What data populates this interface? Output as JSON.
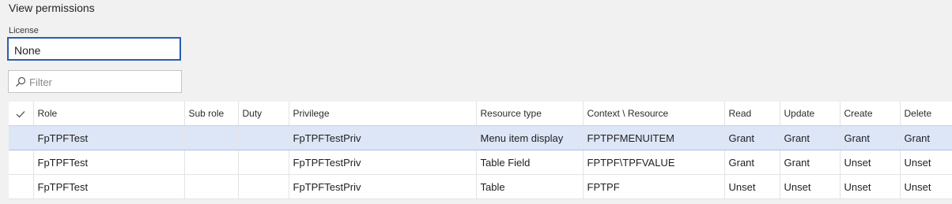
{
  "header": {
    "title": "View permissions"
  },
  "license": {
    "label": "License",
    "value": "None"
  },
  "filter": {
    "placeholder": "Filter"
  },
  "grid": {
    "columns": [
      "Role",
      "Sub role",
      "Duty",
      "Privilege",
      "Resource type",
      "Context \\ Resource",
      "Read",
      "Update",
      "Create",
      "Delete"
    ],
    "rows": [
      [
        "FpTPFTest",
        "",
        "",
        "FpTPFTestPriv",
        "Menu item display",
        "FPTPFMENUITEM",
        "Grant",
        "Grant",
        "Grant",
        "Grant"
      ],
      [
        "FpTPFTest",
        "",
        "",
        "FpTPFTestPriv",
        "Table Field",
        "FPTPF\\TPFVALUE",
        "Grant",
        "Grant",
        "Unset",
        "Unset"
      ],
      [
        "FpTPFTest",
        "",
        "",
        "FpTPFTestPriv",
        "Table",
        "FPTPF",
        "Unset",
        "Unset",
        "Unset",
        "Unset"
      ]
    ],
    "selected_row": 0
  },
  "icons": {
    "filter": "search-icon",
    "select_all": "checkmark-icon"
  },
  "colors": {
    "selected_row": "#dde6f7",
    "input_border_focus": "#2a5db0"
  }
}
